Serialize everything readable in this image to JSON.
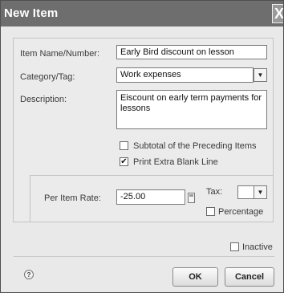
{
  "window": {
    "title": "New Item",
    "close_glyph": "X"
  },
  "form": {
    "item_name_label": "Item Name/Number:",
    "item_name_value": "Early Bird discount on lesson",
    "category_label": "Category/Tag:",
    "category_value": "Work expenses",
    "description_label": "Description:",
    "description_value": "Eiscount on early term payments for lessons",
    "subtotal_label": "Subtotal of the Preceding Items",
    "subtotal_checked": false,
    "print_blank_label": "Print Extra Blank Line",
    "print_blank_checked": true
  },
  "rate": {
    "label": "Per Item Rate:",
    "value": "-25.00",
    "tax_label": "Tax:",
    "tax_value": "",
    "percentage_label": "Percentage",
    "percentage_checked": false
  },
  "footer": {
    "inactive_label": "Inactive",
    "inactive_checked": false,
    "help_glyph": "?",
    "ok_label": "OK",
    "cancel_label": "Cancel"
  },
  "glyphs": {
    "dropdown": "▼",
    "checkmark": "✔"
  },
  "colors": {
    "titlebar": "#6e6e6e",
    "dialog_bg": "#e9e9e9"
  }
}
